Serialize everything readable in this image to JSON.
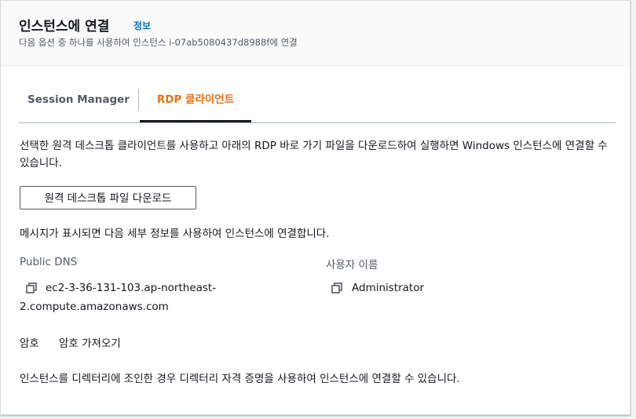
{
  "header": {
    "title": "인스턴스에 연결",
    "info_link": "정보",
    "subtitle": "다음 옵션 중 하나를 사용하여 인스턴스 i-07ab5080437d8988f에 연결"
  },
  "tabs": [
    {
      "label": "Session Manager",
      "selected": false
    },
    {
      "label": "RDP 클라이언트",
      "selected": true
    }
  ],
  "rdp": {
    "description": "선택한 원격 데스크톱 클라이언트를 사용하고 아래의 RDP 바로 가기 파일을 다운로드하여 실행하면 Windows 인스턴스에 연결할 수 있습니다.",
    "download_button": "원격 데스크톱 파일 다운로드",
    "prompt_text": "메시지가 표시되면 다음 세부 정보를 사용하여 인스턴스에 연결합니다.",
    "public_dns_label": "Public DNS",
    "public_dns_line1": "ec2-3-36-131-103.ap-northeast-",
    "public_dns_line2": "2.compute.amazonaws.com",
    "username_label": "사용자 이름",
    "username_value": "Administrator",
    "password_label": "암호",
    "password_link": "암호 가져오기",
    "footer_text": "인스턴스를 디렉터리에 조인한 경우 디렉터리 자격 증명을 사용하여 인스턴스에 연결할 수 있습니다."
  },
  "colors": {
    "accent_selected_tab": "#ec7211",
    "link": "#0073bb"
  },
  "icons": {
    "copy": "copy-icon"
  }
}
